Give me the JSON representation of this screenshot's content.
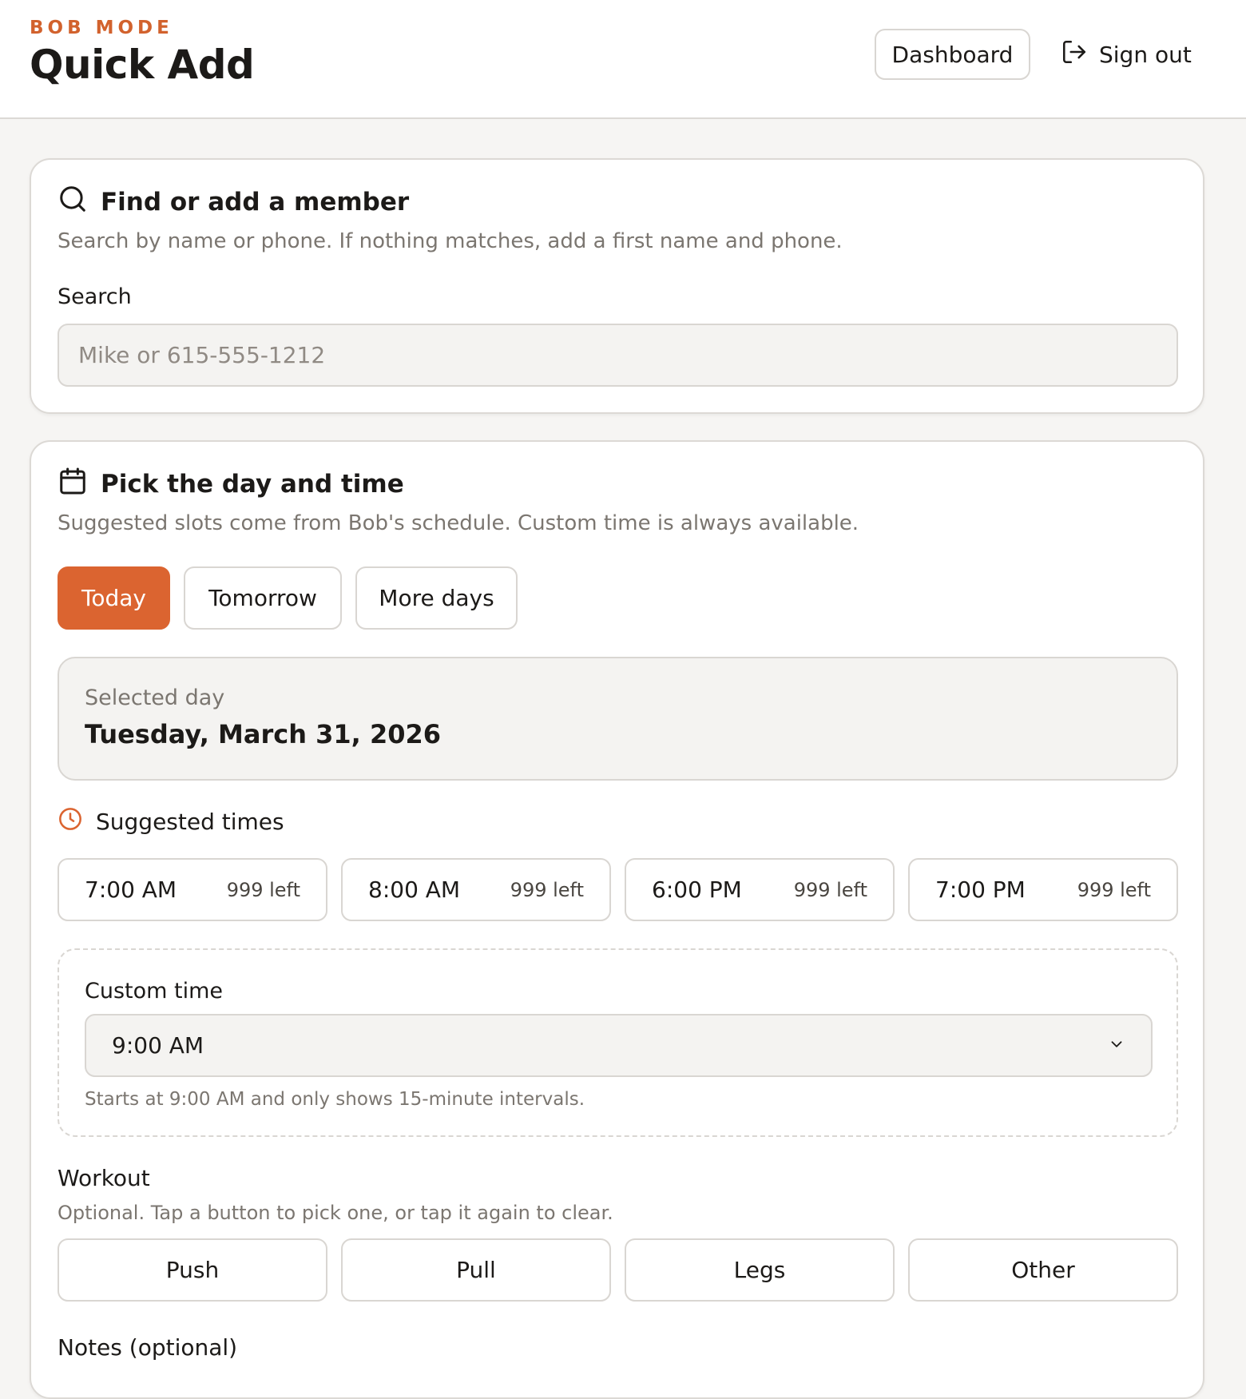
{
  "header": {
    "eyebrow": "BOB MODE",
    "title": "Quick Add",
    "dashboard_label": "Dashboard",
    "signout_label": "Sign out",
    "signout_icon": "sign-out-icon"
  },
  "member_card": {
    "icon": "search-icon",
    "title": "Find or add a member",
    "subtitle": "Search by name or phone. If nothing matches, add a first name and phone.",
    "search_label": "Search",
    "search_value": "",
    "search_placeholder": "Mike or 615-555-1212"
  },
  "schedule_card": {
    "icon": "calendar-icon",
    "title": "Pick the day and time",
    "subtitle": "Suggested slots come from Bob's schedule. Custom time is always available.",
    "day_tabs": [
      {
        "label": "Today",
        "selected": true
      },
      {
        "label": "Tomorrow",
        "selected": false
      },
      {
        "label": "More days",
        "selected": false
      }
    ],
    "selected_day_label": "Selected day",
    "selected_day_value": "Tuesday, March 31, 2026",
    "suggested_icon": "clock-icon",
    "suggested_label": "Suggested times",
    "slots": [
      {
        "time": "7:00 AM",
        "remaining": "999 left"
      },
      {
        "time": "8:00 AM",
        "remaining": "999 left"
      },
      {
        "time": "6:00 PM",
        "remaining": "999 left"
      },
      {
        "time": "7:00 PM",
        "remaining": "999 left"
      }
    ],
    "custom_time_label": "Custom time",
    "custom_time_value": "9:00 AM",
    "custom_time_hint": "Starts at 9:00 AM and only shows 15-minute intervals.",
    "workout_label": "Workout",
    "workout_subtitle": "Optional. Tap a button to pick one, or tap it again to clear.",
    "workouts": [
      "Push",
      "Pull",
      "Legs",
      "Other"
    ],
    "notes_label": "Notes (optional)"
  },
  "colors": {
    "accent": "#db6430",
    "eyebrow": "#d2622d",
    "border": "#d9d6d2",
    "page_bg": "#f6f5f3"
  }
}
